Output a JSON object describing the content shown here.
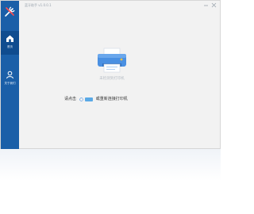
{
  "window": {
    "title": "蓝牙助手 v1.0.0.1"
  },
  "sidebar": {
    "logo": "tools-icon",
    "items": [
      {
        "label": "首页",
        "icon": "home-icon",
        "active": true
      },
      {
        "label": "关于我们",
        "icon": "user-icon",
        "active": false
      }
    ]
  },
  "main": {
    "status": "未检测到打印机",
    "instruction_prefix": "请点击",
    "instruction_suffix": "或重新连接打印机"
  },
  "colors": {
    "sidebar": "#1a5fa8",
    "sidebar_active": "#0f4c8f",
    "accent": "#4a90e2",
    "background": "#f2f2f2"
  }
}
